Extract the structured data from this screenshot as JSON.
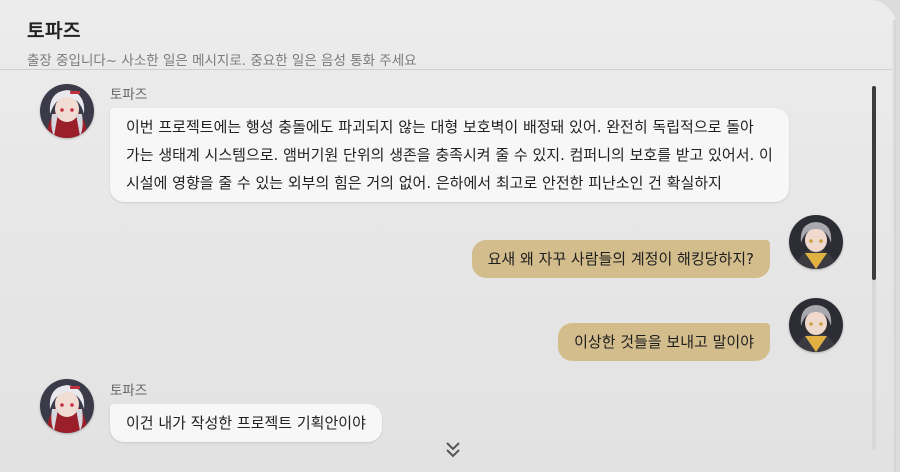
{
  "header": {
    "contact_name": "토파즈",
    "status": "출장 중입니다~ 사소한 일은 메시지로. 중요한 일은 음성 통화 주세요"
  },
  "messages": [
    {
      "direction": "incoming",
      "sender": "토파즈",
      "lines": [
        "이번 프로젝트에는 행성 충돌에도 파괴되지 않는 대형 보호벽이 배정돼 있어. 완전히 독립적으로 돌아",
        "가는 생태계 시스템으로. 앰버기원 단위의 생존을 충족시켜 줄 수 있지. 컴퍼니의 보호를 받고 있어서. 이",
        " 시설에 영향을 줄 수 있는 외부의 힘은 거의 없어. 은하에서 최고로 안전한 피난소인 건 확실하지"
      ]
    },
    {
      "direction": "outgoing",
      "text": "요새 왜 자꾸 사람들의 계정이 해킹당하지?"
    },
    {
      "direction": "outgoing",
      "text": "이상한 것들을 보내고 말이야"
    },
    {
      "direction": "incoming",
      "sender": "토파즈",
      "text": "이건 내가 작성한 프로젝트 기획안이야"
    }
  ],
  "icons": {
    "contact_avatar": "topaz-avatar",
    "user_avatar": "trailblazer-avatar",
    "scroll_more": "double-chevron-down-icon"
  },
  "colors": {
    "outgoing_bubble": "#d3bd8c",
    "incoming_bubble": "#f7f7f7"
  }
}
